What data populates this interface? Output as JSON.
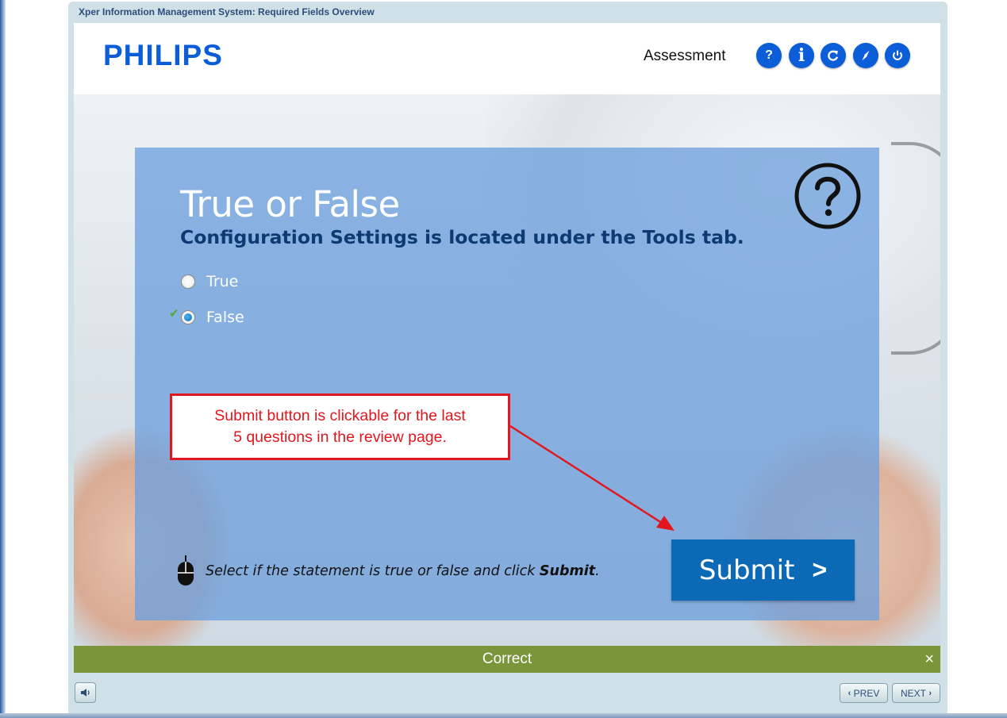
{
  "window": {
    "title": "Xper Information Management System: Required Fields Overview"
  },
  "header": {
    "logo": "PHILIPS",
    "module": "Assessment",
    "buttons": [
      {
        "icon": "help-icon",
        "glyph": "?"
      },
      {
        "icon": "info-icon",
        "glyph": "i"
      },
      {
        "icon": "replay-icon",
        "glyph": ""
      },
      {
        "icon": "compass-icon",
        "glyph": ""
      },
      {
        "icon": "power-icon",
        "glyph": ""
      }
    ]
  },
  "question": {
    "type_title": "True or False",
    "statement": "Configuration Settings is located under the Tools tab.",
    "options": [
      {
        "label": "True",
        "selected": false,
        "correct": false
      },
      {
        "label": "False",
        "selected": true,
        "correct": true
      }
    ],
    "instruction_prefix": "Select if the statement is true or false and click ",
    "instruction_bold": "Submit",
    "instruction_suffix": ".",
    "submit_label": "Submit",
    "submit_arrow": ">"
  },
  "callout": {
    "line1": "Submit button is clickable for the last",
    "line2": "5 questions in the review page.",
    "color": "#e2171d"
  },
  "feedback": {
    "text": "Correct",
    "close": "×",
    "color": "#7a953a"
  },
  "navigation": {
    "prev_label": "PREV",
    "next_label": "NEXT"
  },
  "colors": {
    "accent": "#0b5ed7",
    "submit": "#0b69b5",
    "title_text": "#0d3a73"
  }
}
